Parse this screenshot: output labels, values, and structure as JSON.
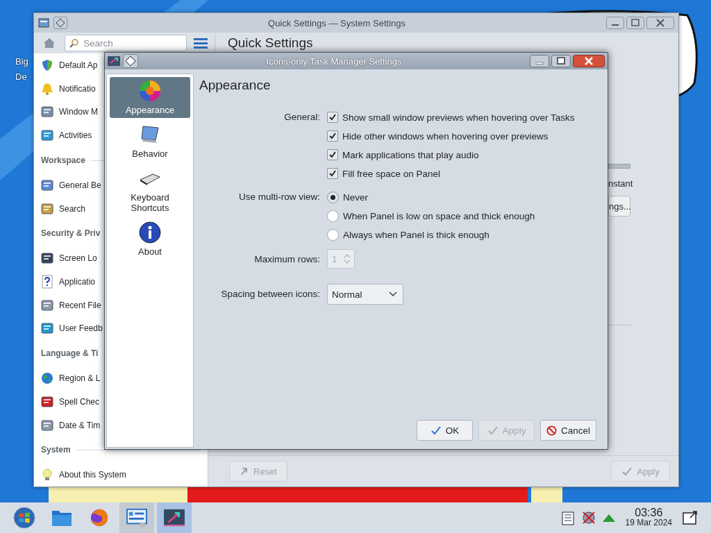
{
  "desktop": {
    "icon_label_lines": [
      "Big",
      "De"
    ]
  },
  "background_window": {
    "title": "Quick Settings — System Settings",
    "search": {
      "placeholder": "Search"
    },
    "heading": "Quick Settings",
    "sidebar": [
      {
        "kind": "item",
        "label": "Default Ap"
      },
      {
        "kind": "item",
        "label": "Notificatio"
      },
      {
        "kind": "item",
        "label": "Window M"
      },
      {
        "kind": "item",
        "label": "Activities"
      },
      {
        "kind": "header",
        "label": "Workspace"
      },
      {
        "kind": "item",
        "label": "General Be"
      },
      {
        "kind": "item",
        "label": "Search"
      },
      {
        "kind": "header",
        "label": "Security & Priv"
      },
      {
        "kind": "item",
        "label": "Screen Lo"
      },
      {
        "kind": "item",
        "label": "Applicatio"
      },
      {
        "kind": "item",
        "label": "Recent File"
      },
      {
        "kind": "item",
        "label": "User Feedb"
      },
      {
        "kind": "header",
        "label": "Language & Ti"
      },
      {
        "kind": "item",
        "label": "Region & L"
      },
      {
        "kind": "item",
        "label": "Spell Chec"
      },
      {
        "kind": "item",
        "label": "Date & Tim"
      },
      {
        "kind": "header",
        "label": "System"
      },
      {
        "kind": "item",
        "label": "About this System"
      }
    ],
    "slider_label": "nstant",
    "settings_button": "ngs...",
    "footer": [
      {
        "kind": "reset",
        "label": "Reset",
        "disabled": true
      },
      {
        "kind": "apply",
        "label": "Apply",
        "disabled": true
      }
    ]
  },
  "dialog": {
    "title": "Icons-only Task Manager Settings",
    "pages": [
      {
        "label": "Appearance",
        "selected": true
      },
      {
        "label": "Behavior",
        "selected": false
      },
      {
        "label": "Keyboard Shortcuts",
        "selected": false
      },
      {
        "label": "About",
        "selected": false
      }
    ],
    "heading": "Appearance",
    "general": {
      "label": "General:",
      "options": [
        {
          "label": "Show small window previews when hovering over Tasks",
          "checked": true
        },
        {
          "label": "Hide other windows when hovering over previews",
          "checked": true
        },
        {
          "label": "Mark applications that play audio",
          "checked": true
        },
        {
          "label": "Fill free space on Panel",
          "checked": true
        }
      ]
    },
    "multirow": {
      "label": "Use multi-row view:",
      "options": [
        {
          "label": "Never",
          "selected": true
        },
        {
          "label": "When Panel is low on space and thick enough",
          "selected": false
        },
        {
          "label": "Always when Panel is thick enough",
          "selected": false
        }
      ]
    },
    "max_rows": {
      "label": "Maximum rows:",
      "value": "1",
      "disabled": true
    },
    "spacing": {
      "label": "Spacing between icons:",
      "value": "Normal"
    },
    "buttons": [
      {
        "kind": "ok",
        "label": "OK",
        "disabled": false
      },
      {
        "kind": "apply",
        "label": "Apply",
        "disabled": true
      },
      {
        "kind": "cancel",
        "label": "Cancel",
        "disabled": false
      }
    ]
  },
  "taskbar": {
    "apps": [
      {
        "running": false,
        "selected": false
      },
      {
        "running": false,
        "selected": false
      },
      {
        "running": false,
        "selected": false
      },
      {
        "running": true,
        "selected": false
      },
      {
        "running": true,
        "selected": true
      }
    ],
    "clock": {
      "time": "03:36",
      "date": "19 Mar 2024"
    }
  }
}
